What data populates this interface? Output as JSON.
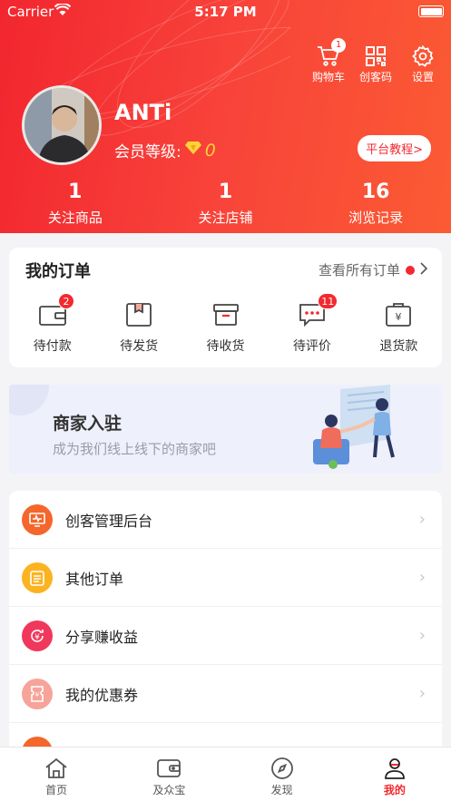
{
  "status_bar": {
    "carrier": "Carrier",
    "time": "5:17 PM"
  },
  "header": {
    "actions": [
      {
        "label": "购物车",
        "icon": "cart-icon",
        "badge": "1"
      },
      {
        "label": "创客码",
        "icon": "qr-code-icon"
      },
      {
        "label": "设置",
        "icon": "gear-icon"
      }
    ],
    "username": "ANTi",
    "member_label": "会员等级:",
    "member_level": "0",
    "tutorial_button": "平台教程>",
    "stats": [
      {
        "value": "1",
        "label": "关注商品"
      },
      {
        "value": "1",
        "label": "关注店铺"
      },
      {
        "value": "16",
        "label": "浏览记录"
      }
    ]
  },
  "orders": {
    "title": "我的订单",
    "view_all": "查看所有订单",
    "items": [
      {
        "label": "待付款",
        "badge": "2",
        "icon": "wallet-icon"
      },
      {
        "label": "待发货",
        "badge": "",
        "icon": "box-icon"
      },
      {
        "label": "待收货",
        "badge": "",
        "icon": "inbox-icon"
      },
      {
        "label": "待评价",
        "badge": "11",
        "icon": "comment-icon"
      },
      {
        "label": "退货款",
        "badge": "",
        "icon": "refund-icon"
      }
    ]
  },
  "merchant": {
    "title": "商家入驻",
    "subtitle": "成为我们线上线下的商家吧"
  },
  "menu": [
    {
      "label": "创客管理后台",
      "icon": "monitor-icon",
      "color": "#f4662b"
    },
    {
      "label": "其他订单",
      "icon": "clipboard-icon",
      "color": "#fbb320"
    },
    {
      "label": "分享赚收益",
      "icon": "yen-refresh-icon",
      "color": "#f0385c"
    },
    {
      "label": "我的优惠券",
      "icon": "coupon-icon",
      "color": "#f6a49a"
    }
  ],
  "tabbar": [
    {
      "label": "首页",
      "icon": "home-icon"
    },
    {
      "label": "及众宝",
      "icon": "wallet-icon"
    },
    {
      "label": "发现",
      "icon": "compass-icon"
    },
    {
      "label": "我的",
      "icon": "user-icon",
      "active": true
    }
  ],
  "colors": {
    "brand": "#f22a2f",
    "accent": "#fb5b33"
  }
}
